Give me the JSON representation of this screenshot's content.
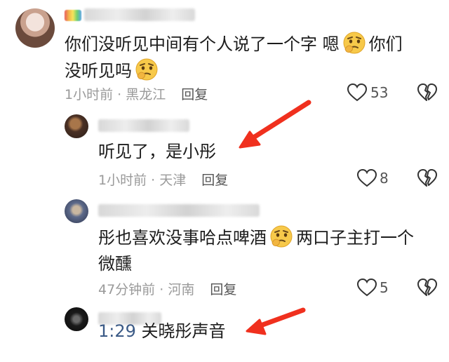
{
  "comments": [
    {
      "text_a": "你们没听见中间有个人说了一个字 嗯",
      "text_b": "你们",
      "text_c": "没听见吗",
      "time": "1小时前",
      "location": "黑龙江",
      "reply": "回复",
      "likes": "53"
    },
    {
      "text": "听见了，是小彤",
      "time": "1小时前",
      "location": "天津",
      "reply": "回复",
      "likes": "8"
    },
    {
      "text_a": "彤也喜欢没事哈点啤酒",
      "text_b": "两口子主打一个",
      "text_c": "微醺",
      "time": "47分钟前",
      "location": "河南",
      "reply": "回复",
      "likes": "5"
    },
    {
      "audio_time": "1:29",
      "text": "关晓彤声音"
    }
  ],
  "meta_separator": " · ",
  "icons": {
    "like": "heart-outline-icon",
    "dislike": "broken-heart-icon",
    "emoji": "thinking-face-emoji",
    "arrow": "red-arrow-annotation"
  },
  "colors": {
    "arrow": "#f0301e",
    "meta": "#9a9a9a",
    "link": "#3b5a86"
  }
}
